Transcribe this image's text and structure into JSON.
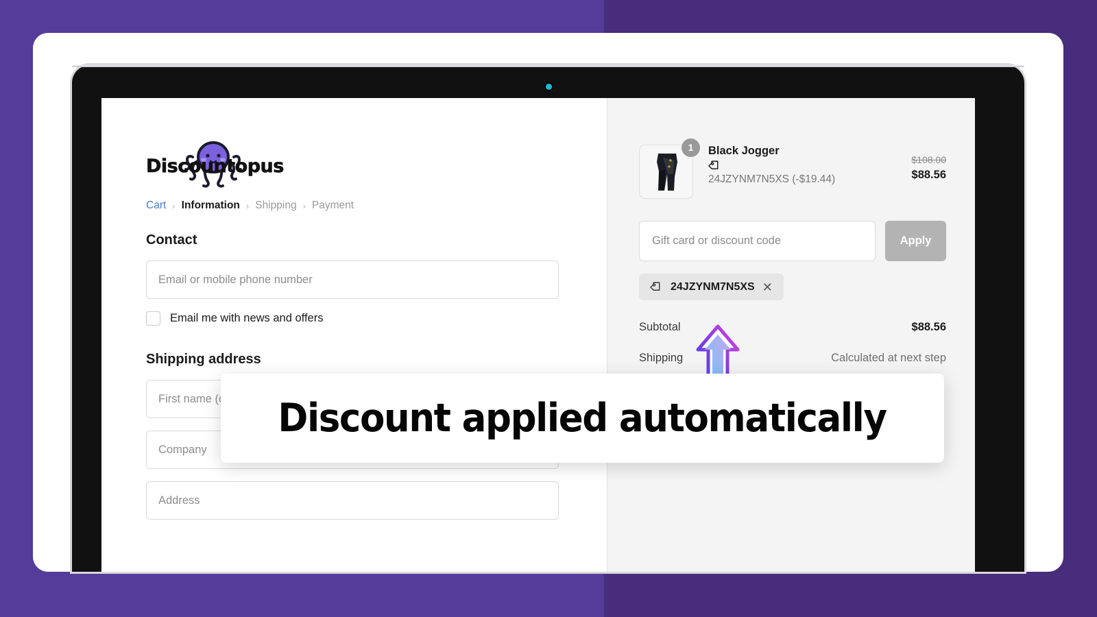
{
  "theme": {
    "bg_left": "#553C9A",
    "bg_right": "#472D7B",
    "accent_purple": "#7B61DD",
    "camera_dot": "#13BDD4",
    "apply_button": "#B3B3B3"
  },
  "brand": {
    "logo_text": "Discountopus",
    "logo_icon": "octopus-icon"
  },
  "breadcrumb": {
    "items": [
      {
        "label": "Cart",
        "state": "link"
      },
      {
        "label": "Information",
        "state": "active"
      },
      {
        "label": "Shipping",
        "state": "muted"
      },
      {
        "label": "Payment",
        "state": "muted"
      }
    ],
    "separator": "›"
  },
  "contact": {
    "title": "Contact",
    "email_placeholder": "Email or mobile phone number",
    "email_value": "",
    "newsletter_label": "Email me with news and offers",
    "newsletter_checked": false
  },
  "shipping": {
    "title": "Shipping address",
    "fields": [
      {
        "placeholder": "First name (optional)",
        "value": ""
      },
      {
        "placeholder": "Company",
        "value": ""
      },
      {
        "placeholder": "Address",
        "value": ""
      }
    ]
  },
  "order_summary": {
    "product": {
      "name": "Black Jogger",
      "quantity": "1",
      "discount_icon": "tag-icon",
      "discount_text": "24JZYNM7N5XS (-$19.44)",
      "price_original": "$108.00",
      "price_final": "$88.56",
      "thumbnail_alt": "black-jogger-thumbnail"
    },
    "discount_field": {
      "placeholder": "Gift card or discount code",
      "value": "",
      "apply_label": "Apply"
    },
    "applied_code": {
      "icon": "tag-icon",
      "label": "24JZYNM7N5XS",
      "remove_icon": "close-icon"
    },
    "totals": [
      {
        "label": "Subtotal",
        "value": "$88.56",
        "muted": false
      },
      {
        "label": "Shipping",
        "value": "Calculated at next step",
        "muted": true
      }
    ]
  },
  "callout": {
    "text": "Discount applied automatically",
    "pointer_icon": "arrow-up-icon"
  }
}
